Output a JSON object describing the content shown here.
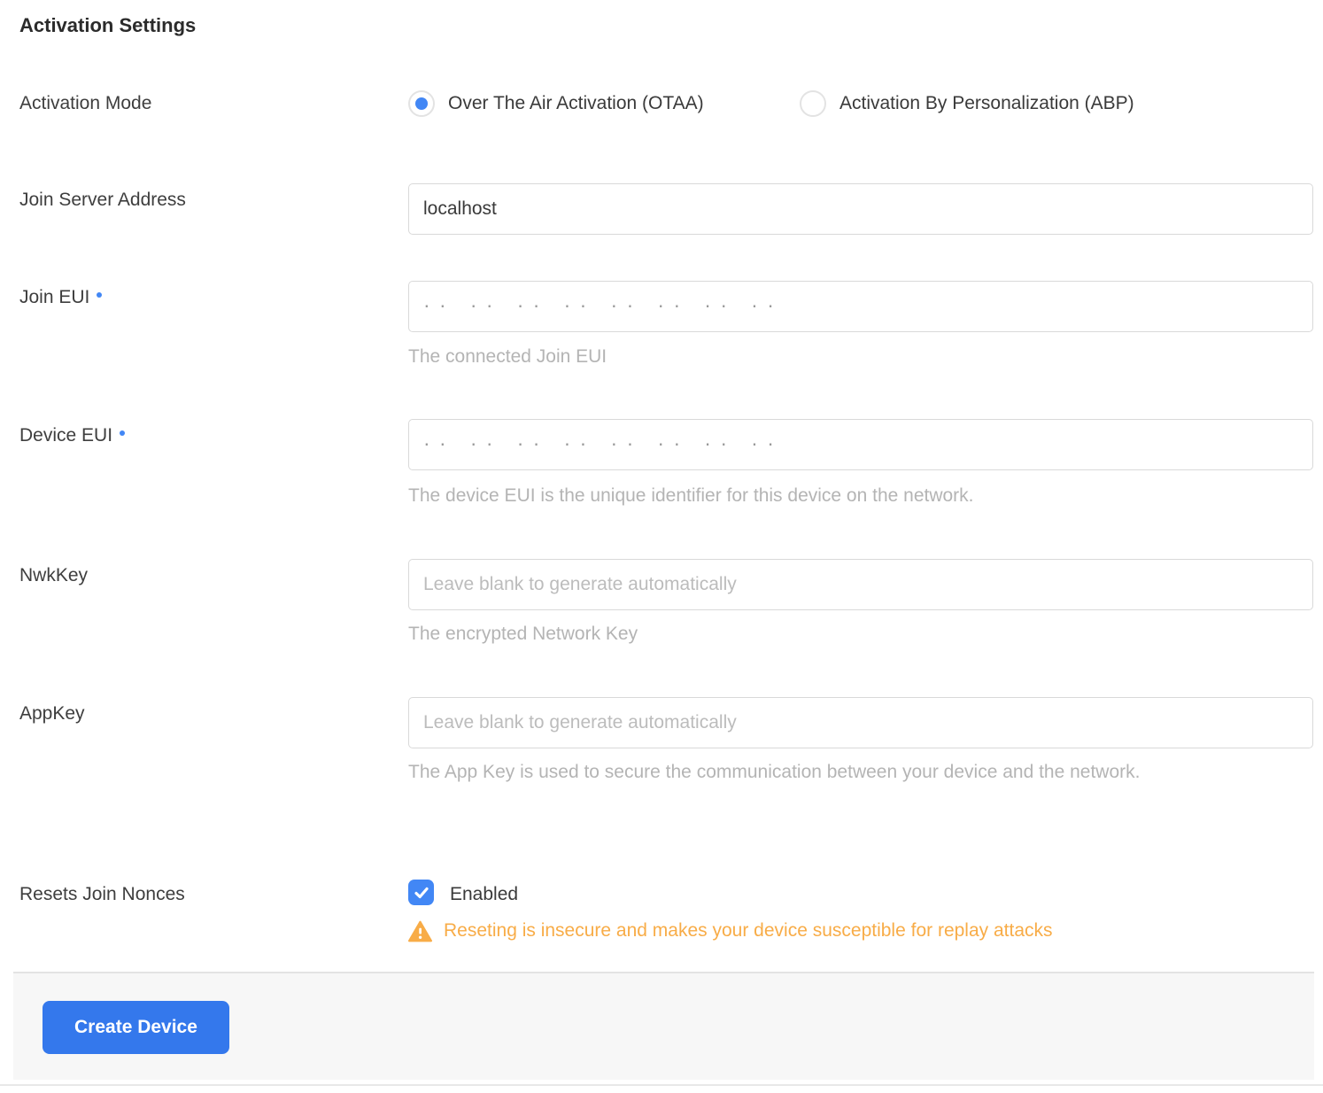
{
  "section": {
    "title": "Activation Settings"
  },
  "colors": {
    "accent": "#4287f5",
    "button_primary": "#3478ec",
    "warning": "#f8ac47",
    "input_border": "#d9d9d9",
    "help_text": "#b4b4b4",
    "footer_background": "#f7f7f7"
  },
  "form": {
    "activation_mode": {
      "label": "Activation Mode",
      "options": [
        {
          "label": "Over The Air Activation (OTAA)",
          "selected": true
        },
        {
          "label": "Activation By Personalization (ABP)",
          "selected": false
        }
      ]
    },
    "join_server_address": {
      "label": "Join Server Address",
      "value": "localhost"
    },
    "join_eui": {
      "label": "Join EUI",
      "required": true,
      "placeholder": "· ·   · ·   · ·   · ·   · ·   · ·   · ·   · ·",
      "help": "The connected Join EUI"
    },
    "device_eui": {
      "label": "Device EUI",
      "required": true,
      "placeholder": "· ·   · ·   · ·   · ·   · ·   · ·   · ·   · ·",
      "help": "The device EUI is the unique identifier for this device on the network."
    },
    "nwk_key": {
      "label": "NwkKey",
      "required": false,
      "placeholder": "Leave blank to generate automatically",
      "help": "The encrypted Network Key"
    },
    "app_key": {
      "label": "AppKey",
      "required": false,
      "placeholder": "Leave blank to generate automatically",
      "help": "The App Key is used to secure the communication between your device and the network."
    },
    "resets_join_nonces": {
      "label": "Resets Join Nonces",
      "checkbox_label": "Enabled",
      "checked": true,
      "warning": "Reseting is insecure and makes your device susceptible for replay attacks"
    }
  },
  "footer": {
    "create_button_label": "Create Device"
  }
}
